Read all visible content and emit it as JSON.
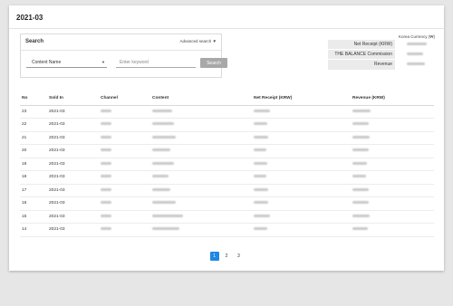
{
  "page": {
    "title": "2021-03"
  },
  "search": {
    "heading": "Search",
    "advanced_label": "Advanced search ▼",
    "select_value": "Content Name",
    "keyword_placeholder": "Enter keyword",
    "button_label": "Search"
  },
  "summary": {
    "currency_note": "Korea Currency (₩)",
    "rows": [
      {
        "label": "Net Receipt (KRW)"
      },
      {
        "label": "THE BALANCE Commission"
      },
      {
        "label": "Revenue"
      }
    ]
  },
  "table": {
    "headers": {
      "no": "No",
      "sold_in": "Sold In",
      "channel": "Channel",
      "content": "Content",
      "net_receipt": "Net Receipt (KRW)",
      "revenue": "Revenue (KRW)"
    },
    "rows": [
      {
        "no": "23",
        "sold_in": "2021-03"
      },
      {
        "no": "22",
        "sold_in": "2021-03"
      },
      {
        "no": "21",
        "sold_in": "2021-03"
      },
      {
        "no": "20",
        "sold_in": "2021-03"
      },
      {
        "no": "19",
        "sold_in": "2021-03"
      },
      {
        "no": "18",
        "sold_in": "2021-03"
      },
      {
        "no": "17",
        "sold_in": "2021-03"
      },
      {
        "no": "16",
        "sold_in": "2021-03"
      },
      {
        "no": "15",
        "sold_in": "2021-03"
      },
      {
        "no": "14",
        "sold_in": "2021-03"
      }
    ]
  },
  "pagination": {
    "pages": [
      "1",
      "2",
      "3"
    ],
    "current": "1"
  },
  "colors": {
    "accent": "#1e88e5",
    "button": "#a8a8a8",
    "background": "#e6e6e6"
  },
  "icons": {
    "dropdown": "caret-down-icon"
  }
}
